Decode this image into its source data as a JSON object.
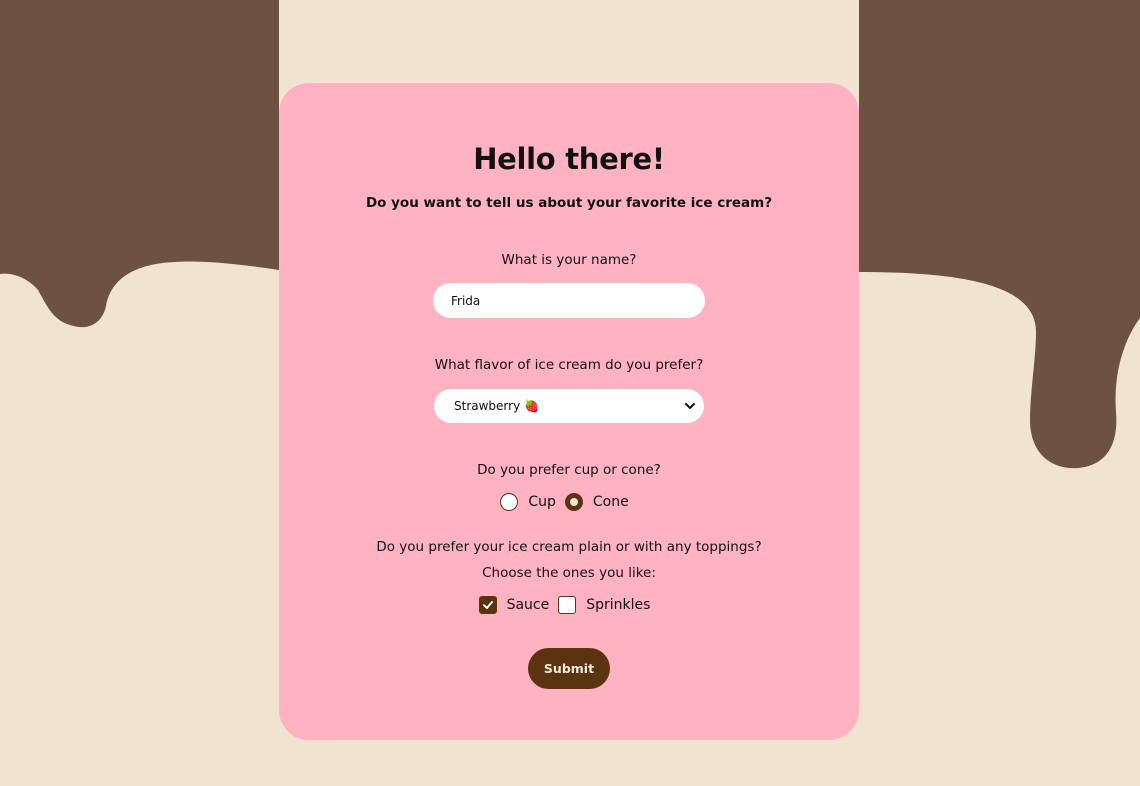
{
  "colors": {
    "page_background": "#f0e3cf",
    "chocolate": "#6d5242",
    "card_background": "#ffb3c2",
    "accent": "#5a3411"
  },
  "header": {
    "title": "Hello there!",
    "subtitle": "Do you want to tell us about your favorite ice cream?"
  },
  "name_field": {
    "label": "What is your name?",
    "value": "Frida"
  },
  "flavor_field": {
    "label": "What flavor of ice cream do you prefer?",
    "selected": "Strawberry 🍓",
    "chevron_icon": "chevron-down-icon"
  },
  "serving_field": {
    "label": "Do you prefer cup or cone?",
    "options": [
      {
        "label": "Cup",
        "checked": false
      },
      {
        "label": "Cone",
        "checked": true
      }
    ]
  },
  "toppings_field": {
    "label": "Do you prefer your ice cream plain or with any toppings?",
    "sublabel": "Choose the ones you like:",
    "options": [
      {
        "label": "Sauce",
        "checked": true
      },
      {
        "label": "Sprinkles",
        "checked": false
      }
    ]
  },
  "submit": {
    "label": "Submit"
  }
}
